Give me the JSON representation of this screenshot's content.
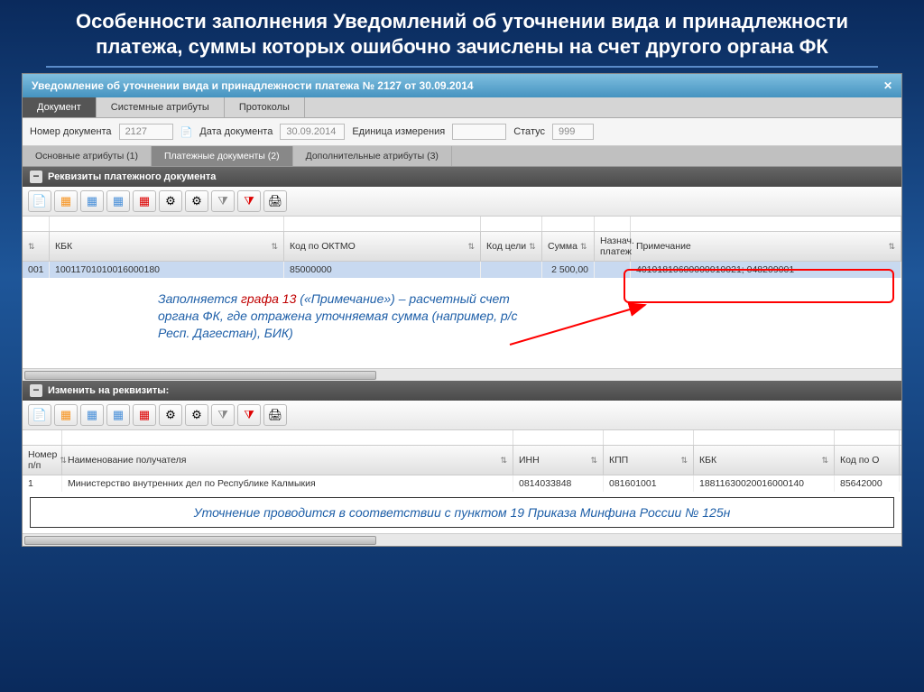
{
  "slide_title": "Особенности заполнения Уведомлений об уточнении вида и принадлежности платежа, суммы которых ошибочно зачислены на счет другого органа ФК",
  "app_header": "Уведомление об уточнении вида и принадлежности платежа № 2127 от 30.09.2014",
  "main_tabs": [
    "Документ",
    "Системные атрибуты",
    "Протоколы"
  ],
  "form": {
    "doc_num_label": "Номер документа",
    "doc_num": "2127",
    "doc_date_label": "Дата документа",
    "doc_date": "30.09.2014",
    "unit_label": "Единица измерения",
    "unit": "",
    "status_label": "Статус",
    "status": "999"
  },
  "sub_tabs": [
    "Основные атрибуты (1)",
    "Платежные документы (2)",
    "Дополнительные атрибуты (3)"
  ],
  "section1_title": "Реквизиты платежного документа",
  "section2_title": "Изменить на реквизиты:",
  "grid1": {
    "cols": [
      "",
      "КБК",
      "Код по ОКТМО",
      "Код цели",
      "Сумма",
      "Назнач. платеж",
      "Примечание"
    ],
    "row": {
      "num": "001",
      "kbk": "10011701010016000180",
      "oktmo": "85000000",
      "kod_celi": "",
      "summa": "2 500,00",
      "nazn": "",
      "prim": "40101810600000010021; 048209001"
    }
  },
  "grid2": {
    "cols": [
      "Номер п/п",
      "Наименование получателя",
      "ИНН",
      "КПП",
      "КБК",
      "Код по О"
    ],
    "row": {
      "num": "1",
      "name": "Министерство внутренних дел по Республике Калмыкия",
      "inn": "0814033848",
      "kpp": "081601001",
      "kbk": "18811630020016000140",
      "okt": "85642000"
    }
  },
  "annotation_prefix": "Заполняется ",
  "annotation_red": "графа 13",
  "annotation_rest": " («Примечание») – расчетный счет органа ФК, где отражена уточняемая сумма (например, р/с Респ. Дагестан), БИК)",
  "note": "Уточнение проводится в соответствии с пунктом 19 Приказа Минфина России № 125н"
}
